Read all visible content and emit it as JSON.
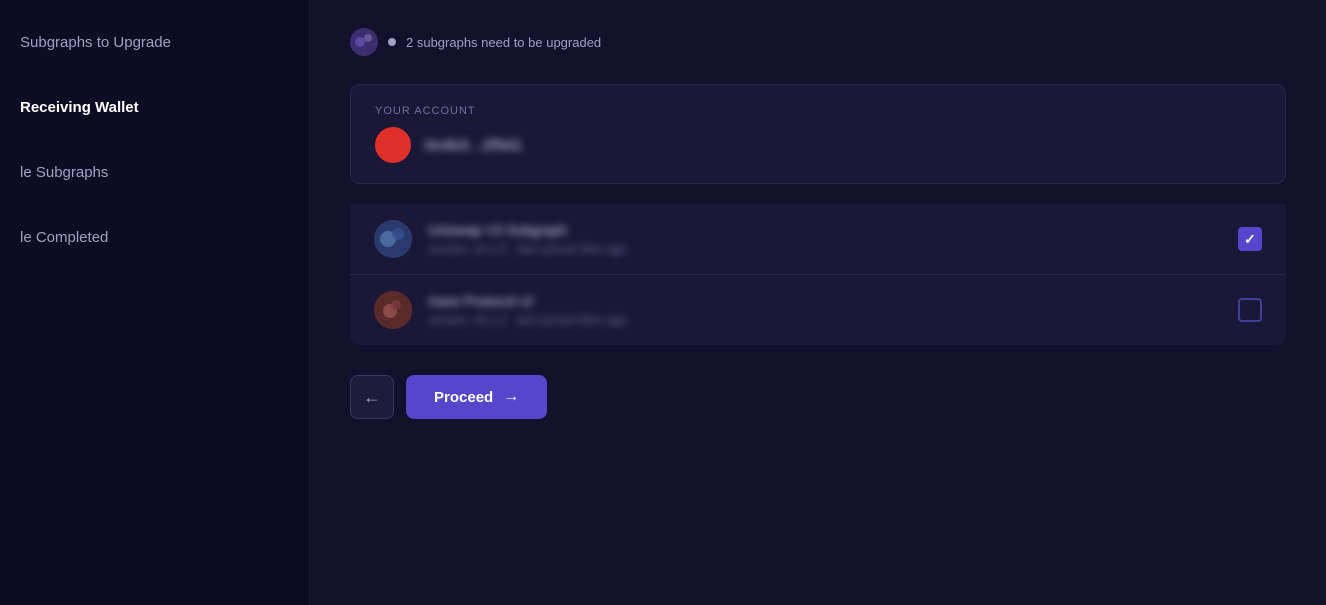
{
  "sidebar": {
    "items": [
      {
        "id": "subgraphs-to-upgrade",
        "label": "Subgraphs to Upgrade",
        "active": false
      },
      {
        "id": "receiving-wallet",
        "label": "Receiving Wallet",
        "active": true
      },
      {
        "id": "le-subgraphs",
        "label": "le Subgraphs",
        "active": false
      },
      {
        "id": "le-completed",
        "label": "le Completed",
        "active": false
      }
    ]
  },
  "notification": {
    "text": "2 subgraphs need to be upgraded"
  },
  "account": {
    "label": "YOUR ACCOUNT",
    "address": "0x4b3...2f9d1",
    "address_display": "0x4b3...2f9d1"
  },
  "subgraphs": [
    {
      "id": "sg-1",
      "title": "Uniswap V3 Subgraph",
      "meta": "version: v0.1.6  ·  last synced 3hrs ago",
      "checked": true,
      "icon": "🌐"
    },
    {
      "id": "sg-2",
      "title": "Aave Protocol v2",
      "meta": "version: v0.1.2  ·  last synced 8hrs ago",
      "checked": false,
      "icon": "👻"
    }
  ],
  "buttons": {
    "back_label": "←",
    "proceed_label": "Proceed",
    "proceed_arrow": "→"
  }
}
